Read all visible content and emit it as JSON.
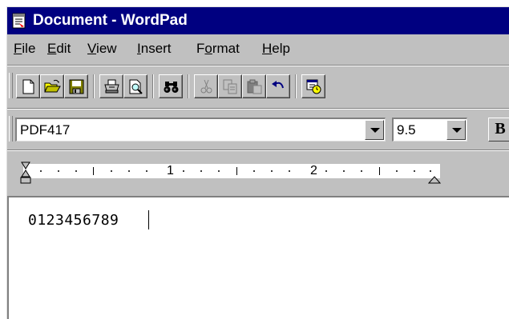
{
  "window": {
    "title": "Document - WordPad",
    "icon": "wordpad-document-icon"
  },
  "menu": [
    {
      "label": "File",
      "mnemonic": "F",
      "rest": "ile"
    },
    {
      "label": "Edit",
      "mnemonic": "E",
      "rest": "dit"
    },
    {
      "label": "View",
      "mnemonic": "V",
      "rest": "iew"
    },
    {
      "label": "Insert",
      "mnemonic": "I",
      "rest": "nsert"
    },
    {
      "label": "Format",
      "pre": "F",
      "mnemonic": "o",
      "rest": "rmat"
    },
    {
      "label": "Help",
      "mnemonic": "H",
      "rest": "elp"
    }
  ],
  "toolbar": {
    "buttons": [
      {
        "icon": "new-document-icon",
        "enabled": true
      },
      {
        "icon": "open-folder-icon",
        "enabled": true
      },
      {
        "icon": "save-disk-icon",
        "enabled": true
      },
      {
        "icon": "print-icon",
        "enabled": true
      },
      {
        "icon": "print-preview-icon",
        "enabled": true
      },
      {
        "icon": "find-binoculars-icon",
        "enabled": true
      },
      {
        "icon": "cut-scissors-icon",
        "enabled": false
      },
      {
        "icon": "copy-icon",
        "enabled": false
      },
      {
        "icon": "paste-icon",
        "enabled": false
      },
      {
        "icon": "undo-icon",
        "enabled": true
      },
      {
        "icon": "insert-date-time-icon",
        "enabled": true
      }
    ]
  },
  "format": {
    "font_name": "PDF417",
    "font_size": "9.5",
    "bold_label": "B"
  },
  "ruler": {
    "numbers": [
      "1",
      "2"
    ]
  },
  "document": {
    "text": "0123456789"
  }
}
